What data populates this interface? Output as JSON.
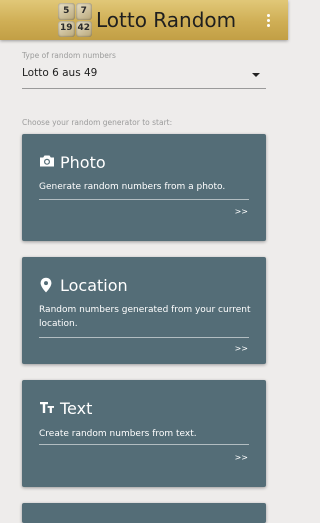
{
  "app": {
    "title": "Lotto Random",
    "logo_numbers": [
      "5",
      "7",
      "19",
      "42"
    ]
  },
  "type_selector": {
    "label": "Type of random numbers",
    "value": "Lotto 6 aus 49"
  },
  "generator_prompt": "Choose your random generator to start:",
  "cards": [
    {
      "icon": "camera-icon",
      "title": "Photo",
      "description": "Generate random numbers from a photo.",
      "arrow": ">>"
    },
    {
      "icon": "location-pin-icon",
      "title": "Location",
      "description": "Random numbers generated from your current location.",
      "arrow": ">>"
    },
    {
      "icon": "text-format-icon",
      "title": "Text",
      "description": "Create random numbers from text.",
      "arrow": ">>"
    }
  ],
  "colors": {
    "appbar": "#cfae55",
    "card": "#546d77",
    "background": "#eeeceb"
  }
}
